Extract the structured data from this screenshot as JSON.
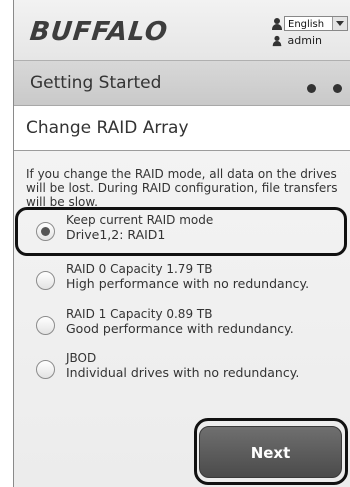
{
  "header": {
    "logo": "BUFFALO",
    "language": "English",
    "user": "admin"
  },
  "title_bar": {
    "title": "Getting Started"
  },
  "subtitle": "Change RAID Array",
  "warning": "If you change the RAID mode, all data on the drives will be lost. During RAID configuration, file transfers will be slow.",
  "options": [
    {
      "line1": "Keep current RAID mode",
      "line2": "Drive1,2: RAID1",
      "selected": true
    },
    {
      "line1": "RAID 0 Capacity 1.79 TB",
      "line2": "High performance with no redundancy.",
      "selected": false
    },
    {
      "line1": "RAID 1 Capacity 0.89 TB",
      "line2": "Good performance with redundancy.",
      "selected": false
    },
    {
      "line1": "JBOD",
      "line2": "Individual drives with no redundancy.",
      "selected": false
    }
  ],
  "next_button": "Next"
}
